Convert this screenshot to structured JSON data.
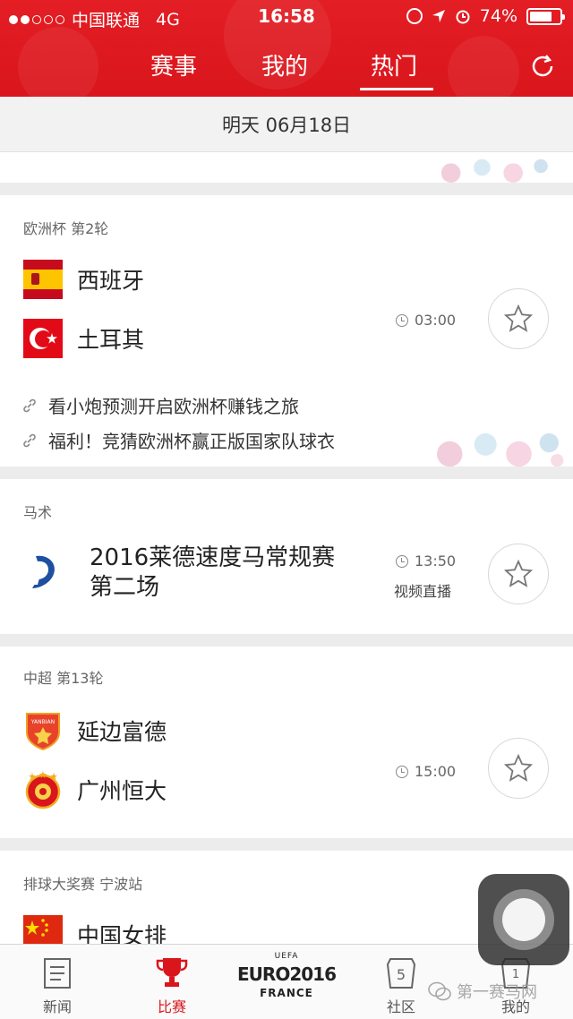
{
  "status_bar": {
    "carrier": "中国联通",
    "network": "4G",
    "time": "16:58",
    "battery": "74%"
  },
  "top_tabs": [
    {
      "label": "赛事"
    },
    {
      "label": "我的"
    },
    {
      "label": "热门"
    }
  ],
  "date_header": "明天 06月18日",
  "events": [
    {
      "league": "欧洲杯 第2轮",
      "team1": "西班牙",
      "team2": "土耳其",
      "time": "03:00",
      "links": [
        "看小炮预测开启欧洲杯赚钱之旅",
        "福利！竞猜欧洲杯赢正版国家队球衣"
      ]
    },
    {
      "league": "马术",
      "title_line1": "2016莱德速度马常规赛",
      "title_line2": "第二场",
      "time": "13:50",
      "note": "视频直播"
    },
    {
      "league": "中超 第13轮",
      "team1": "延边富德",
      "team2": "广州恒大",
      "team1_badge": "YANBIAN",
      "time": "15:00"
    },
    {
      "league": "排球大奖赛 宁波站",
      "team1": "中国女排"
    }
  ],
  "bottom_tabs": [
    {
      "label": "新闻"
    },
    {
      "label": "比赛"
    },
    {
      "label": "社区",
      "badge": "5"
    },
    {
      "label": "我的",
      "badge": "1"
    }
  ],
  "euro_logo": {
    "top": "UEFA",
    "main": "EURO2016",
    "sub": "FRANCE"
  },
  "watermark": "第一赛马网",
  "colors": {
    "brand_red": "#d9161c",
    "background": "#ececec"
  }
}
